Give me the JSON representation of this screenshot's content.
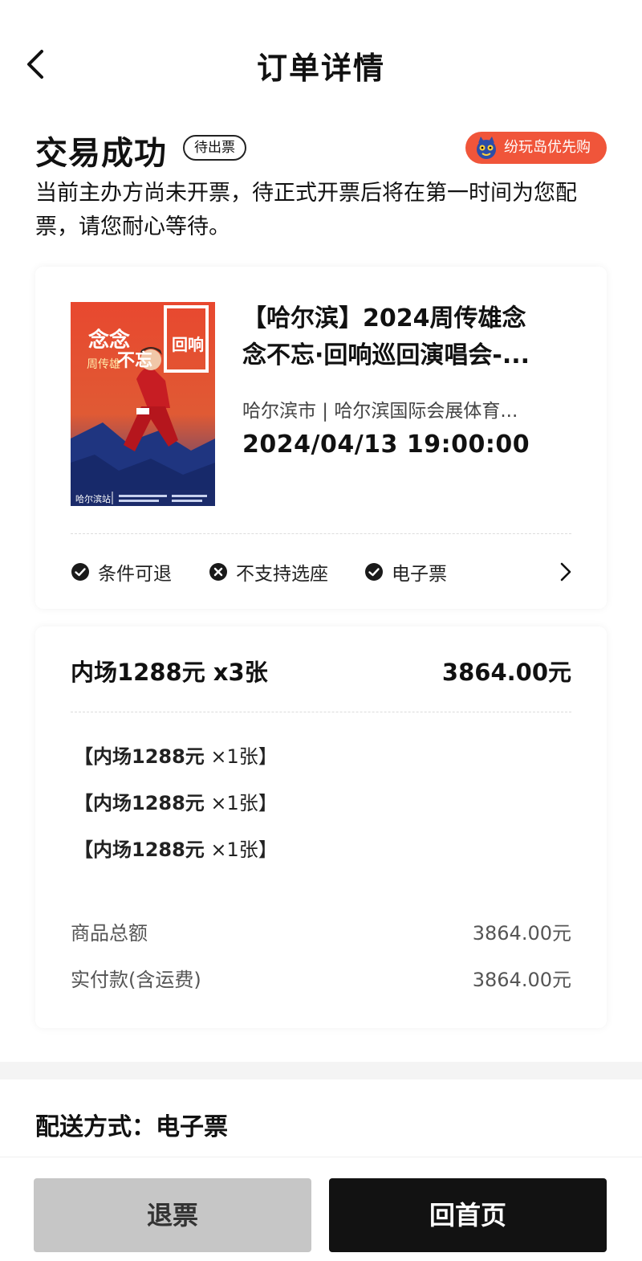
{
  "header": {
    "title": "订单详情"
  },
  "status": {
    "title": "交易成功",
    "badge": "待出票",
    "brand_tag": "纷玩岛优先购",
    "description": "当前主办方尚未开票，待正式开票后将在第一时间为您配票，请您耐心等待。"
  },
  "event": {
    "title_line1": "【哈尔滨】2024周传雄念",
    "title_line2": "念不忘·回响巡回演唱会-...",
    "venue": "哈尔滨市 | 哈尔滨国际会展体育...",
    "datetime": "2024/04/13 19:00:00",
    "poster": {
      "title_line1": "念念",
      "title_line2": "不忘",
      "artist": "周传雄",
      "echo": "回响",
      "city": "哈尔滨站"
    },
    "features": [
      {
        "label": "条件可退",
        "icon": "check-circle-icon"
      },
      {
        "label": "不支持选座",
        "icon": "x-circle-icon"
      },
      {
        "label": "电子票",
        "icon": "check-circle-icon"
      }
    ]
  },
  "order": {
    "summary_label": "内场1288元 x3张",
    "summary_amount": "3864.00元",
    "tickets": [
      {
        "name": "【内场1288元",
        "qty": " ×1张】"
      },
      {
        "name": "【内场1288元",
        "qty": " ×1张】"
      },
      {
        "name": "【内场1288元",
        "qty": " ×1张】"
      }
    ],
    "goods_total_label": "商品总额",
    "goods_total_value": "3864.00元",
    "paid_label": "实付款(含运费)",
    "paid_value": "3864.00元"
  },
  "delivery": {
    "text": "配送方式：电子票"
  },
  "actions": {
    "refund": "退票",
    "home": "回首页"
  },
  "colors": {
    "brand": "#f0553a",
    "primary_button": "#121212",
    "disabled_button": "#c6c6c6"
  }
}
